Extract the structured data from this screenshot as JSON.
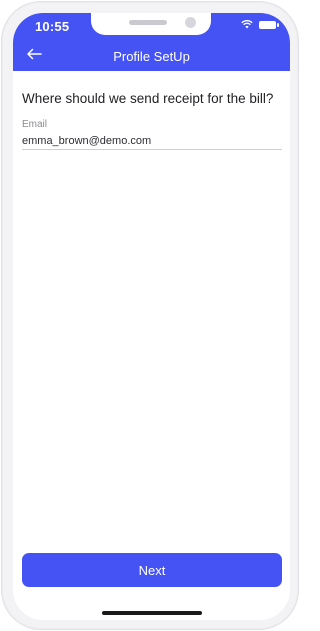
{
  "status_bar": {
    "time": "10:55",
    "icons": [
      "wifi-icon",
      "battery-icon"
    ]
  },
  "header": {
    "title": "Profile SetUp",
    "back_icon": "arrow-left-icon"
  },
  "main": {
    "question": "Where should we send receipt for the bill?",
    "email_label": "Email",
    "email_value": "emma_brown@demo.com"
  },
  "footer": {
    "next_label": "Next"
  },
  "colors": {
    "accent": "#4553f4",
    "background": "#ffffff",
    "text": "#1f1f23",
    "muted": "#8b8b92"
  }
}
